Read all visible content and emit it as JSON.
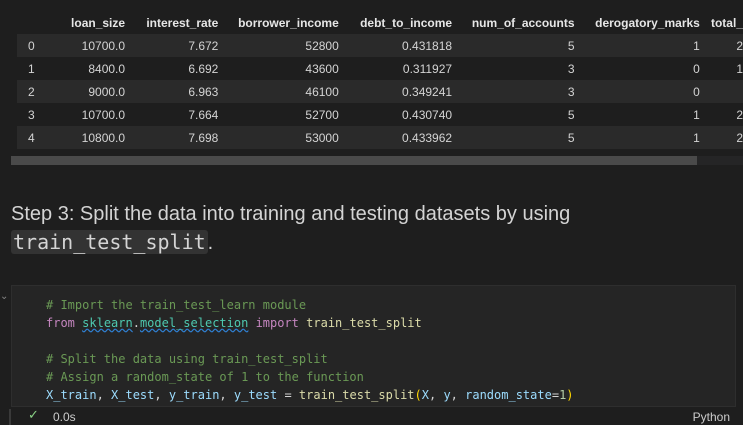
{
  "dataframe": {
    "columns": [
      "",
      "loan_size",
      "interest_rate",
      "borrower_income",
      "debt_to_income",
      "num_of_accounts",
      "derogatory_marks",
      "total_"
    ],
    "rows": [
      [
        "0",
        "10700.0",
        "7.672",
        "52800",
        "0.431818",
        "5",
        "1",
        "2"
      ],
      [
        "1",
        "8400.0",
        "6.692",
        "43600",
        "0.311927",
        "3",
        "0",
        "1"
      ],
      [
        "2",
        "9000.0",
        "6.963",
        "46100",
        "0.349241",
        "3",
        "0",
        ""
      ],
      [
        "3",
        "10700.0",
        "7.664",
        "52700",
        "0.430740",
        "5",
        "1",
        "2"
      ],
      [
        "4",
        "10800.0",
        "7.698",
        "53000",
        "0.433962",
        "5",
        "1",
        "2"
      ]
    ]
  },
  "markdown": {
    "text_before": "Step 3: Split the data into training and testing datasets by using ",
    "inline_code": "train_test_split",
    "text_after": "."
  },
  "code_cell": {
    "lines": [
      {
        "comment": "# Import the train_test_learn module"
      },
      {
        "kw_from": "from",
        "module_a": "sklearn",
        "dot": ".",
        "module_b": "model_selection",
        "kw_import": "import",
        "name": "train_test_split"
      },
      {
        "comment": "# Split the data using train_test_split"
      },
      {
        "comment": "# Assign a random_state of 1 to the function"
      },
      {
        "v1": "X_train",
        "sep1": ", ",
        "v2": "X_test",
        "sep2": ", ",
        "v3": "y_train",
        "sep3": ", ",
        "v4": "y_test",
        "eq": " = ",
        "fn": "train_test_split",
        "lparen": "(",
        "a1": "X",
        "sep4": ", ",
        "a2": "y",
        "sep5": ", ",
        "kw": "random_state",
        "assign": "=",
        "num": "1",
        "rparen": ")"
      }
    ],
    "exec_time": "0.0s",
    "language": "Python",
    "status_icon": "check-icon"
  },
  "colors": {
    "background": "#1e1e1e",
    "comment": "#6a9955",
    "keyword": "#c586c0",
    "module": "#4ec9b0",
    "function": "#dcdcaa",
    "variable": "#9cdcfe",
    "number": "#b5cea8",
    "success": "#89d185"
  }
}
